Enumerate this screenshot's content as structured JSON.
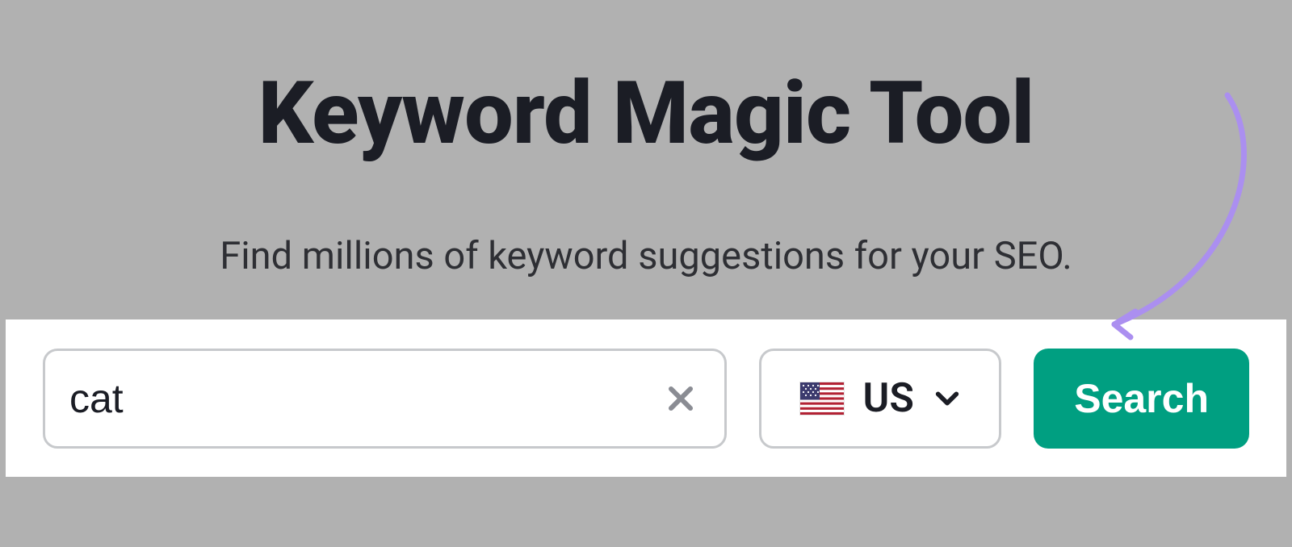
{
  "header": {
    "title": "Keyword Magic Tool",
    "subtitle": "Find millions of keyword suggestions for your SEO."
  },
  "search": {
    "keyword_value": "cat",
    "placeholder": "",
    "country_code": "US",
    "country_flag": "us",
    "button_label": "Search"
  },
  "colors": {
    "accent": "#009f81",
    "annotation": "#ab8ff0"
  }
}
